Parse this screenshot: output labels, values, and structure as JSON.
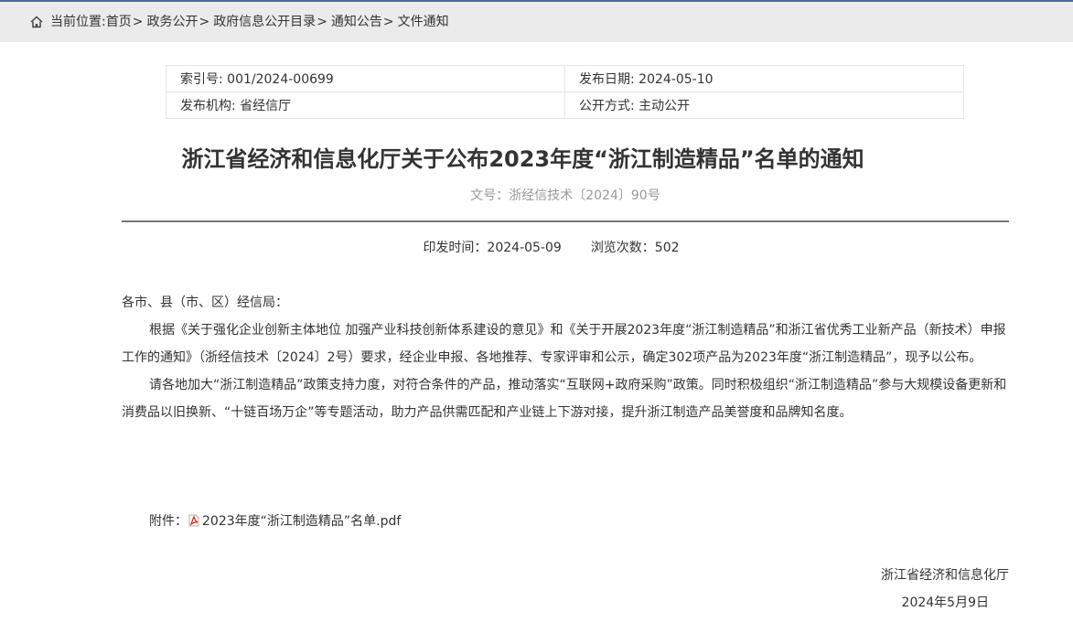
{
  "breadcrumb": {
    "prefix": "当前位置:",
    "items": [
      "首页",
      "政务公开",
      "政府信息公开目录",
      "通知公告",
      "文件通知"
    ],
    "separator": ">"
  },
  "meta": {
    "index_no": "索引号: 001/2024-00699",
    "publish_date": "发布日期: 2024-05-10",
    "publisher": "发布机构: 省经信厅",
    "disclosure": "公开方式: 主动公开"
  },
  "article": {
    "title": "浙江省经济和信息化厅关于公布2023年度“浙江制造精品”名单的通知",
    "doc_no": "文号：浙经信技术〔2024〕90号",
    "print_time": "印发时间：2024-05-09",
    "views": "浏览次数：502",
    "salutation": "各市、县（市、区）经信局：",
    "paragraph1": "根据《关于强化企业创新主体地位 加强产业科技创新体系建设的意见》和《关于开展2023年度“浙江制造精品”和浙江省优秀工业新产品（新技术）申报工作的通知》（浙经信技术〔2024〕2号）要求，经企业申报、各地推荐、专家评审和公示，确定302项产品为2023年度“浙江制造精品”，现予以公布。",
    "paragraph2": "请各地加大“浙江制造精品”政策支持力度，对符合条件的产品，推动落实“互联网+政府采购”政策。同时积极组织“浙江制造精品”参与大规模设备更新和消费品以旧换新、“十链百场万企”等专题活动，助力产品供需匹配和产业链上下游对接，提升浙江制造产品美誉度和品牌知名度。",
    "attachment_label": "附件：",
    "attachment_file": "2023年度“浙江制造精品”名单.pdf",
    "signature": "浙江省经济和信息化厅",
    "sign_date": "2024年5月9日"
  },
  "colors": {
    "accent_line": "#4a6a9a",
    "breadcrumb_bg": "#ebebeb",
    "pdf_red": "#d81e06"
  },
  "icons": {
    "breadcrumb": "home-icon",
    "attachment": "pdf-icon"
  }
}
